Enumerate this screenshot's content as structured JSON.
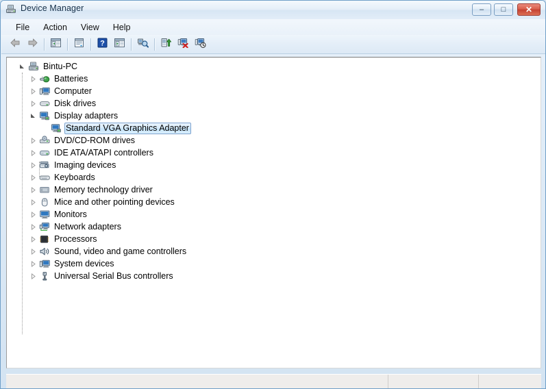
{
  "window": {
    "title": "Device Manager",
    "title_icon": "device-manager-icon",
    "caption_buttons": [
      {
        "name": "minimize-button",
        "glyph": "–"
      },
      {
        "name": "maximize-button",
        "glyph": "□"
      },
      {
        "name": "close-button",
        "glyph": "✕"
      }
    ]
  },
  "menubar": {
    "items": [
      {
        "label": "File"
      },
      {
        "label": "Action"
      },
      {
        "label": "View"
      },
      {
        "label": "Help"
      }
    ]
  },
  "toolbar": {
    "buttons": [
      {
        "name": "back-button",
        "icon": "back-arrow-icon",
        "enabled": false
      },
      {
        "name": "forward-button",
        "icon": "forward-arrow-icon",
        "enabled": false
      },
      {
        "name": "up-one-level-button",
        "icon": "show-hide-console-tree-icon",
        "enabled": true
      },
      {
        "name": "properties-button",
        "icon": "properties-window-icon",
        "enabled": true
      },
      {
        "name": "help-button",
        "icon": "help-question-icon",
        "enabled": true
      },
      {
        "name": "show-hide-action-pane-button",
        "icon": "action-pane-icon",
        "enabled": true
      },
      {
        "name": "scan-for-hardware-changes-button",
        "icon": "scan-hardware-icon",
        "enabled": true
      },
      {
        "name": "update-driver-button",
        "icon": "update-driver-icon",
        "enabled": true
      },
      {
        "name": "uninstall-device-button",
        "icon": "uninstall-device-icon",
        "enabled": true
      },
      {
        "name": "disable-device-button",
        "icon": "disable-device-icon",
        "enabled": true
      }
    ]
  },
  "tree": {
    "root": {
      "label": "Bintu-PC",
      "icon": "computer-root-icon",
      "expanded": true
    },
    "nodes": [
      {
        "label": "Batteries",
        "icon": "battery-icon",
        "expanded": false,
        "selected": false
      },
      {
        "label": "Computer",
        "icon": "computer-icon",
        "expanded": false,
        "selected": false
      },
      {
        "label": "Disk drives",
        "icon": "disk-drive-icon",
        "expanded": false,
        "selected": false
      },
      {
        "label": "Display adapters",
        "icon": "display-adapter-icon",
        "expanded": true,
        "selected": false
      },
      {
        "label": "DVD/CD-ROM drives",
        "icon": "dvd-drive-icon",
        "expanded": false,
        "selected": false
      },
      {
        "label": "IDE ATA/ATAPI controllers",
        "icon": "ide-controller-icon",
        "expanded": false,
        "selected": false
      },
      {
        "label": "Imaging devices",
        "icon": "imaging-device-icon",
        "expanded": false,
        "selected": false
      },
      {
        "label": "Keyboards",
        "icon": "keyboard-icon",
        "expanded": false,
        "selected": false
      },
      {
        "label": "Memory technology driver",
        "icon": "memory-technology-icon",
        "expanded": false,
        "selected": false
      },
      {
        "label": "Mice and other pointing devices",
        "icon": "mouse-icon",
        "expanded": false,
        "selected": false
      },
      {
        "label": "Monitors",
        "icon": "monitor-icon",
        "expanded": false,
        "selected": false
      },
      {
        "label": "Network adapters",
        "icon": "network-adapter-icon",
        "expanded": false,
        "selected": false
      },
      {
        "label": "Processors",
        "icon": "processor-icon",
        "expanded": false,
        "selected": false
      },
      {
        "label": "Sound, video and game controllers",
        "icon": "sound-controller-icon",
        "expanded": false,
        "selected": false
      },
      {
        "label": "System devices",
        "icon": "system-device-icon",
        "expanded": false,
        "selected": false
      },
      {
        "label": "Universal Serial Bus controllers",
        "icon": "usb-controller-icon",
        "expanded": false,
        "selected": false
      }
    ],
    "child_of_display_adapters": {
      "label": "Standard VGA Graphics Adapter",
      "icon": "display-adapter-icon",
      "selected": true
    },
    "expanded_glyph": "◢",
    "collapsed_glyph": "▷"
  },
  "statusbar": {
    "pane1": "",
    "pane2": "",
    "pane3": ""
  },
  "colors": {
    "selection_border": "#7da2ce",
    "selection_fill": "#c5e3f9",
    "close_button": "#c44232",
    "window_border": "#6f9fc8",
    "tree_background": "#ffffff"
  }
}
